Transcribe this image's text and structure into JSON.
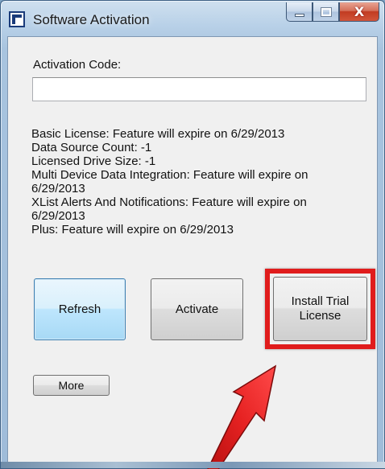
{
  "window": {
    "title": "Software Activation",
    "icon": "app-icon",
    "caption_buttons": {
      "minimize": "minimize-icon",
      "maximize": "maximize-icon",
      "close_glyph": "X"
    }
  },
  "form": {
    "activation_code_label": "Activation Code:",
    "activation_code_value": "",
    "activation_code_placeholder": ""
  },
  "license_info": [
    "Basic License: Feature will expire on 6/29/2013",
    "Data Source Count: -1",
    "Licensed Drive Size: -1",
    "Multi Device Data Integration: Feature will expire on 6/29/2013",
    "XList Alerts And Notifications: Feature will expire on 6/29/2013",
    "Plus: Feature will expire on 6/29/2013"
  ],
  "buttons": {
    "refresh": "Refresh",
    "activate": "Activate",
    "install_trial": "Install Trial License",
    "more": "More"
  },
  "annotation": {
    "highlight_color": "#e01c1c",
    "arrow_color": "#e01c1c"
  }
}
